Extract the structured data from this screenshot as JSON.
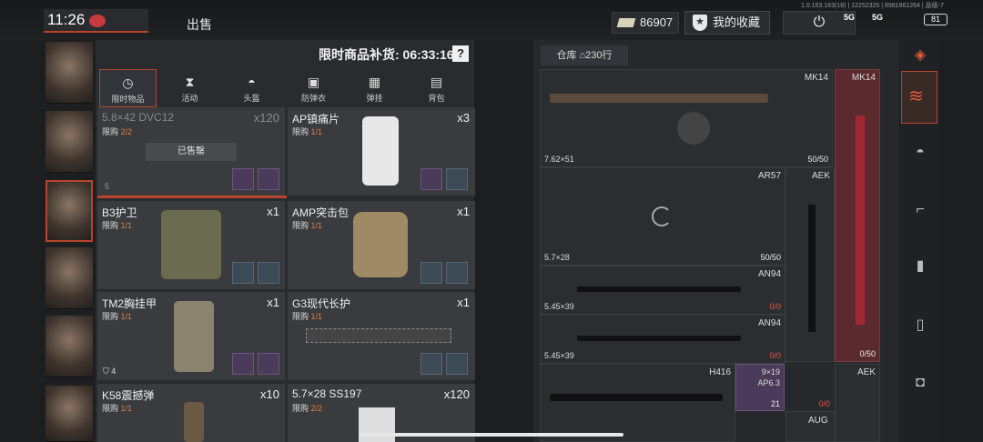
{
  "status": {
    "time": "11:26",
    "version": "1.0.163.163(18) | 12252326 | 8981961264 | 品级-7",
    "signal1": "5G",
    "signal2": "5G",
    "battery": "81"
  },
  "topbar": {
    "sell_tab": "出售",
    "money": "86907",
    "favorites": "我的收藏"
  },
  "shop": {
    "restock": "限时商品补货: 06:33:16",
    "help": "?",
    "categories": [
      {
        "label": "限时物品",
        "icon": "clock-icon"
      },
      {
        "label": "活动",
        "icon": "hourglass-icon"
      },
      {
        "label": "头盔",
        "icon": "helmet-icon"
      },
      {
        "label": "防弹衣",
        "icon": "vest-icon"
      },
      {
        "label": "弹挂",
        "icon": "rig-icon"
      },
      {
        "label": "背包",
        "icon": "backpack-icon"
      }
    ],
    "sold_out": "已售罄",
    "items": [
      {
        "name": "5.8×42 DVC12",
        "limit": "限购",
        "limit_count": "2/2",
        "qty": "x120",
        "extra": "5"
      },
      {
        "name": "AP镇痛片",
        "limit": "限购",
        "limit_count": "1/1",
        "qty": "x3"
      },
      {
        "name": "B3护卫",
        "limit": "限购",
        "limit_count": "1/1",
        "qty": "x1"
      },
      {
        "name": "AMP突击包",
        "limit": "限购",
        "limit_count": "1/1",
        "qty": "x1"
      },
      {
        "name": "TM2胸挂甲",
        "limit": "限购",
        "limit_count": "1/1",
        "qty": "x1",
        "extra": "4"
      },
      {
        "name": "G3现代长护",
        "limit": "限购",
        "limit_count": "1/1",
        "qty": "x1"
      },
      {
        "name": "K58震撼弹",
        "limit": "限购",
        "limit_count": "1/1",
        "qty": "x10"
      },
      {
        "name": "5.7×28 SS197",
        "limit": "限购",
        "limit_count": "2/2",
        "qty": "x120"
      }
    ]
  },
  "warehouse": {
    "tab": "仓库",
    "count": "230行",
    "rows": [
      {
        "name": "MK14",
        "caliber": "7.62×51",
        "count": "50/50"
      },
      {
        "name": "AR57",
        "caliber": "5.7×28",
        "count": "50/50"
      },
      {
        "name": "AN94",
        "caliber": "5.45×39",
        "count": "0/0"
      },
      {
        "name": "AN94",
        "caliber": "5.45×39",
        "count": "0/0"
      },
      {
        "name": "H416",
        "caliber": "",
        "count": ""
      }
    ],
    "side": {
      "mk14": "MK14",
      "mk14_count": "0/50",
      "aek": "AEK",
      "an94_count": "0/0",
      "aek2": "AEK",
      "aug": "AUG",
      "aug_count": "0/0",
      "mag_caliber": "9×19",
      "mag_name": "AP6.3",
      "mag_count": "21"
    }
  },
  "accent": "#b8452b"
}
